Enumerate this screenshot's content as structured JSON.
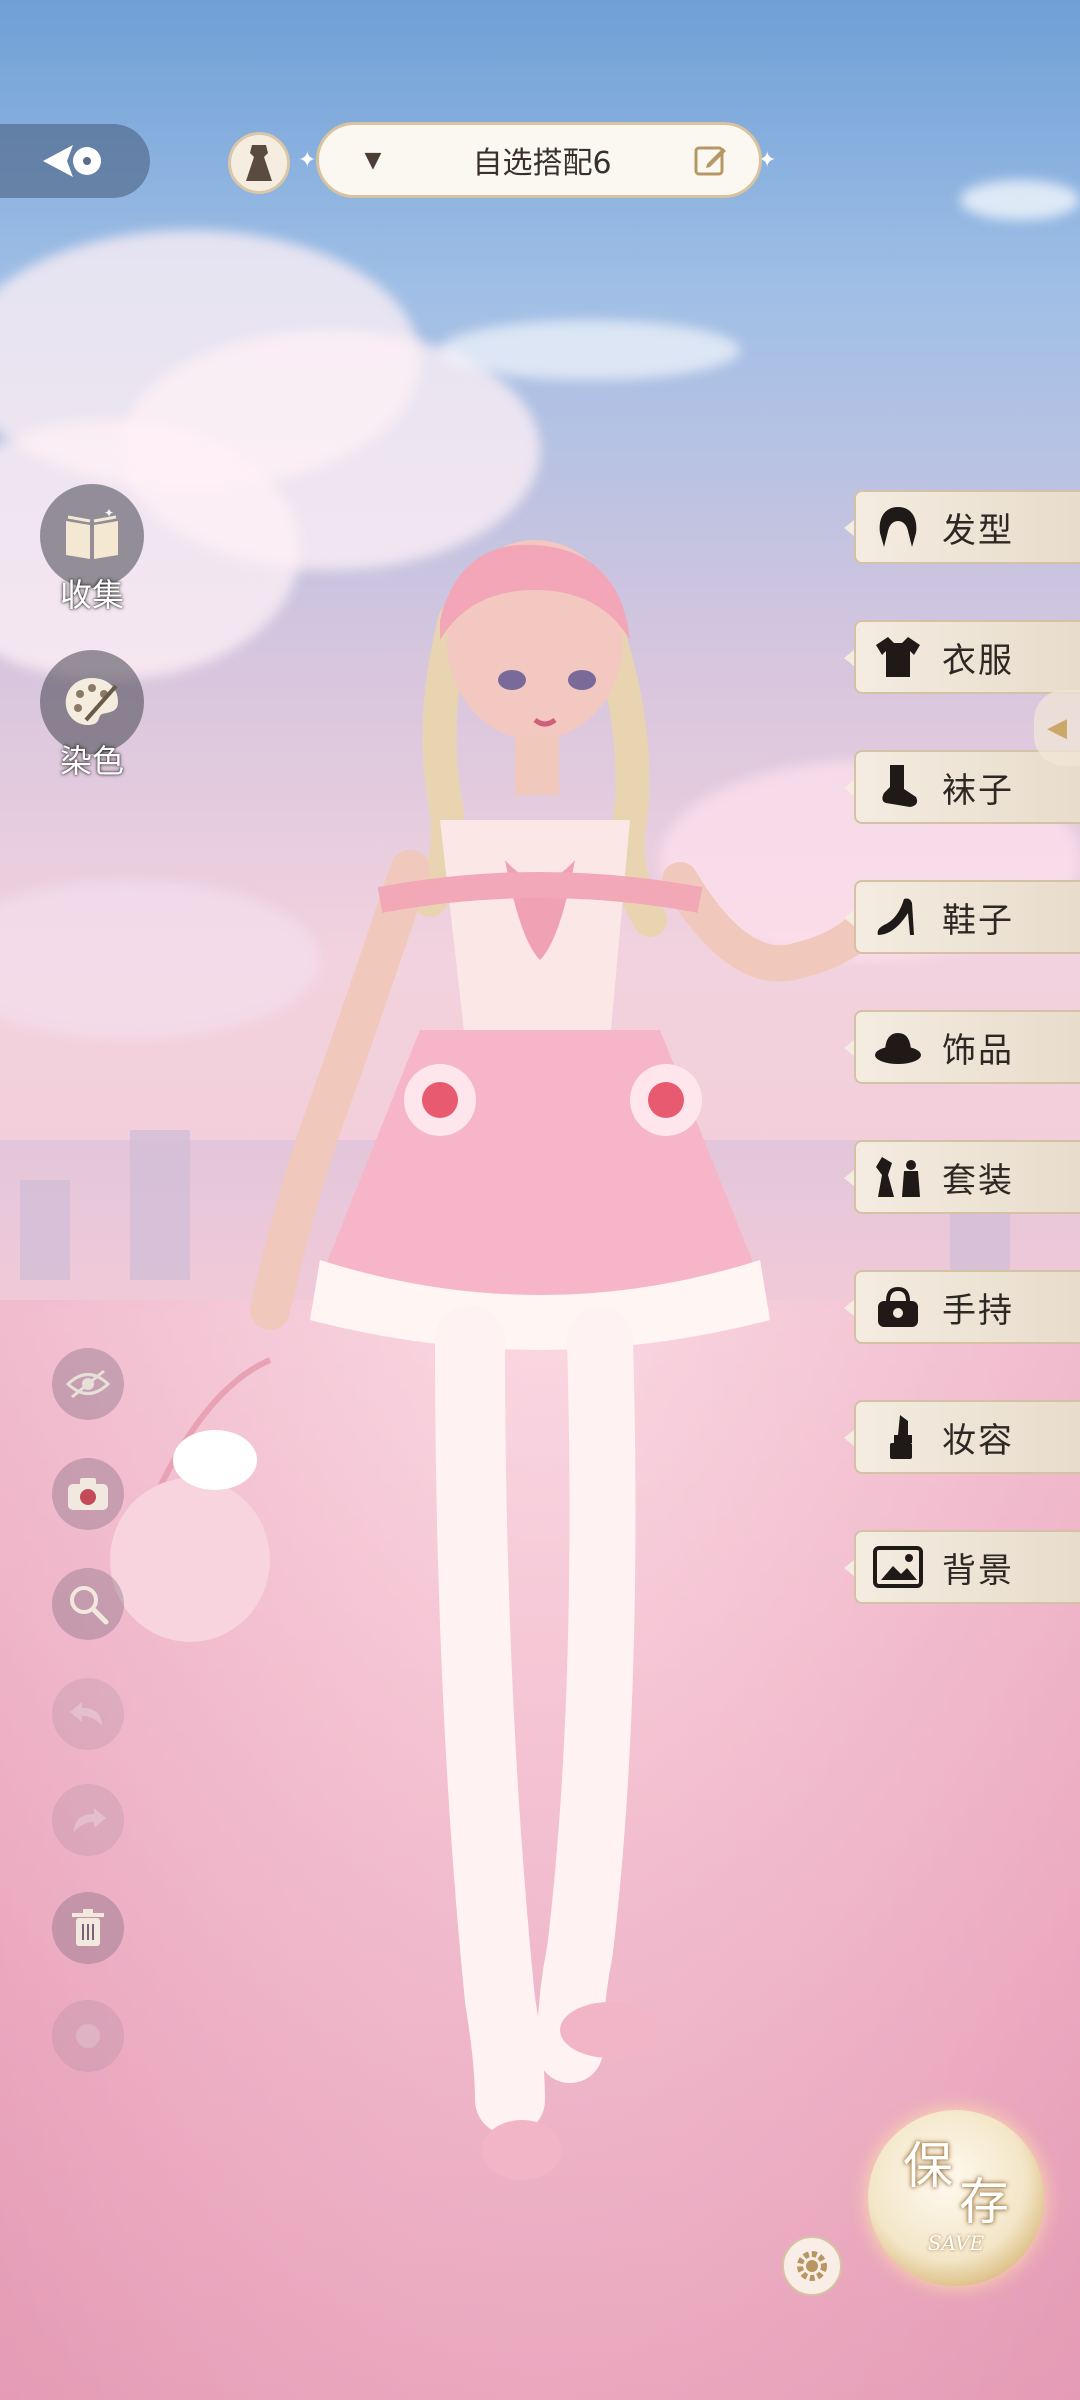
{
  "top_bar": {
    "back_icon": "back-arrow-icon",
    "avatar_icon": "dress-icon",
    "outfit_dropdown_icon": "triangle-down-icon",
    "outfit_name": "自选搭配6",
    "edit_icon": "pencil-edit-icon"
  },
  "left_panel": {
    "collect_label": "收集",
    "dye_label": "染色"
  },
  "tools": {
    "hide_icon": "eye-hidden-icon",
    "camera_icon": "camera-icon",
    "zoom_icon": "magnifier-icon",
    "undo_icon": "undo-icon",
    "redo_icon": "redo-icon",
    "delete_icon": "trash-icon",
    "extra_icon": "circle-icon"
  },
  "categories": [
    {
      "label": "发型",
      "icon": "hair-icon"
    },
    {
      "label": "衣服",
      "icon": "shirt-icon"
    },
    {
      "label": "袜子",
      "icon": "sock-icon"
    },
    {
      "label": "鞋子",
      "icon": "heel-icon"
    },
    {
      "label": "饰品",
      "icon": "hat-icon"
    },
    {
      "label": "套装",
      "icon": "outfit-set-icon"
    },
    {
      "label": "手持",
      "icon": "handbag-icon"
    },
    {
      "label": "妆容",
      "icon": "lipstick-icon"
    },
    {
      "label": "背景",
      "icon": "picture-icon"
    }
  ],
  "save": {
    "label_cn_1": "保",
    "label_cn_2": "存",
    "label_en": "SAVE",
    "settings_icon": "gear-icon"
  },
  "colors": {
    "accent_gold": "#d8c39e",
    "menu_bg": "#f4ece1",
    "text_dark": "#2e2824"
  }
}
